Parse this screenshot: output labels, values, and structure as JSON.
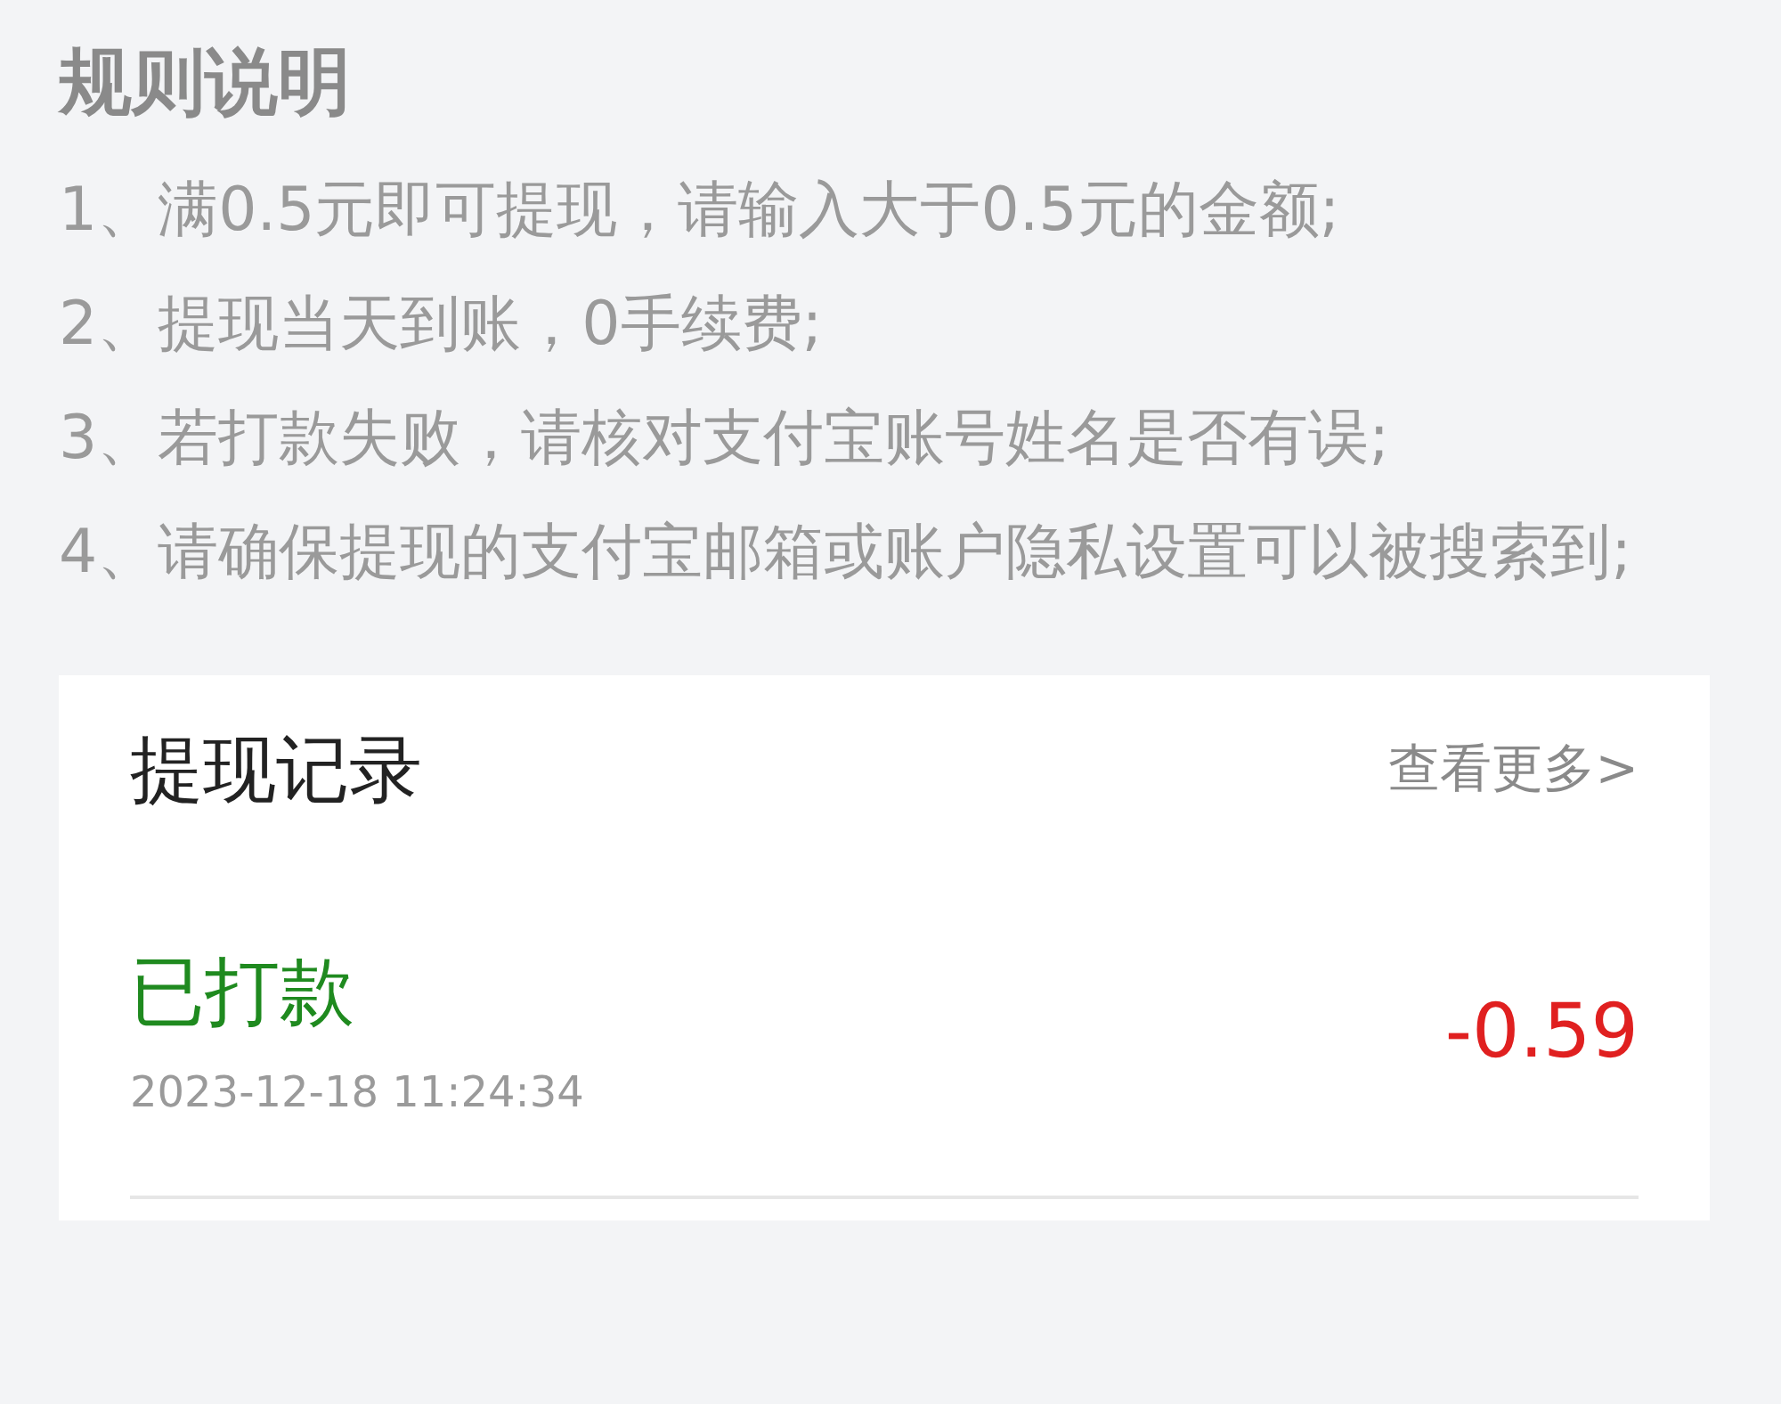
{
  "rules_title": "规则说明",
  "rules": [
    "1、满0.5元即可提现，请输入大于0.5元的金额;",
    "2、提现当天到账，0手续费;",
    "3、若打款失败，请核对支付宝账号姓名是否有误;",
    "4、请确保提现的支付宝邮箱或账户隐私设置可以被搜索到;"
  ],
  "records_card": {
    "title": "提现记录",
    "more_link": "查看更多>",
    "records": [
      {
        "status": "已打款",
        "color": "#1f8a1f",
        "date": "2023-12-18 11:24:34",
        "amount": "-0.59"
      }
    ]
  }
}
